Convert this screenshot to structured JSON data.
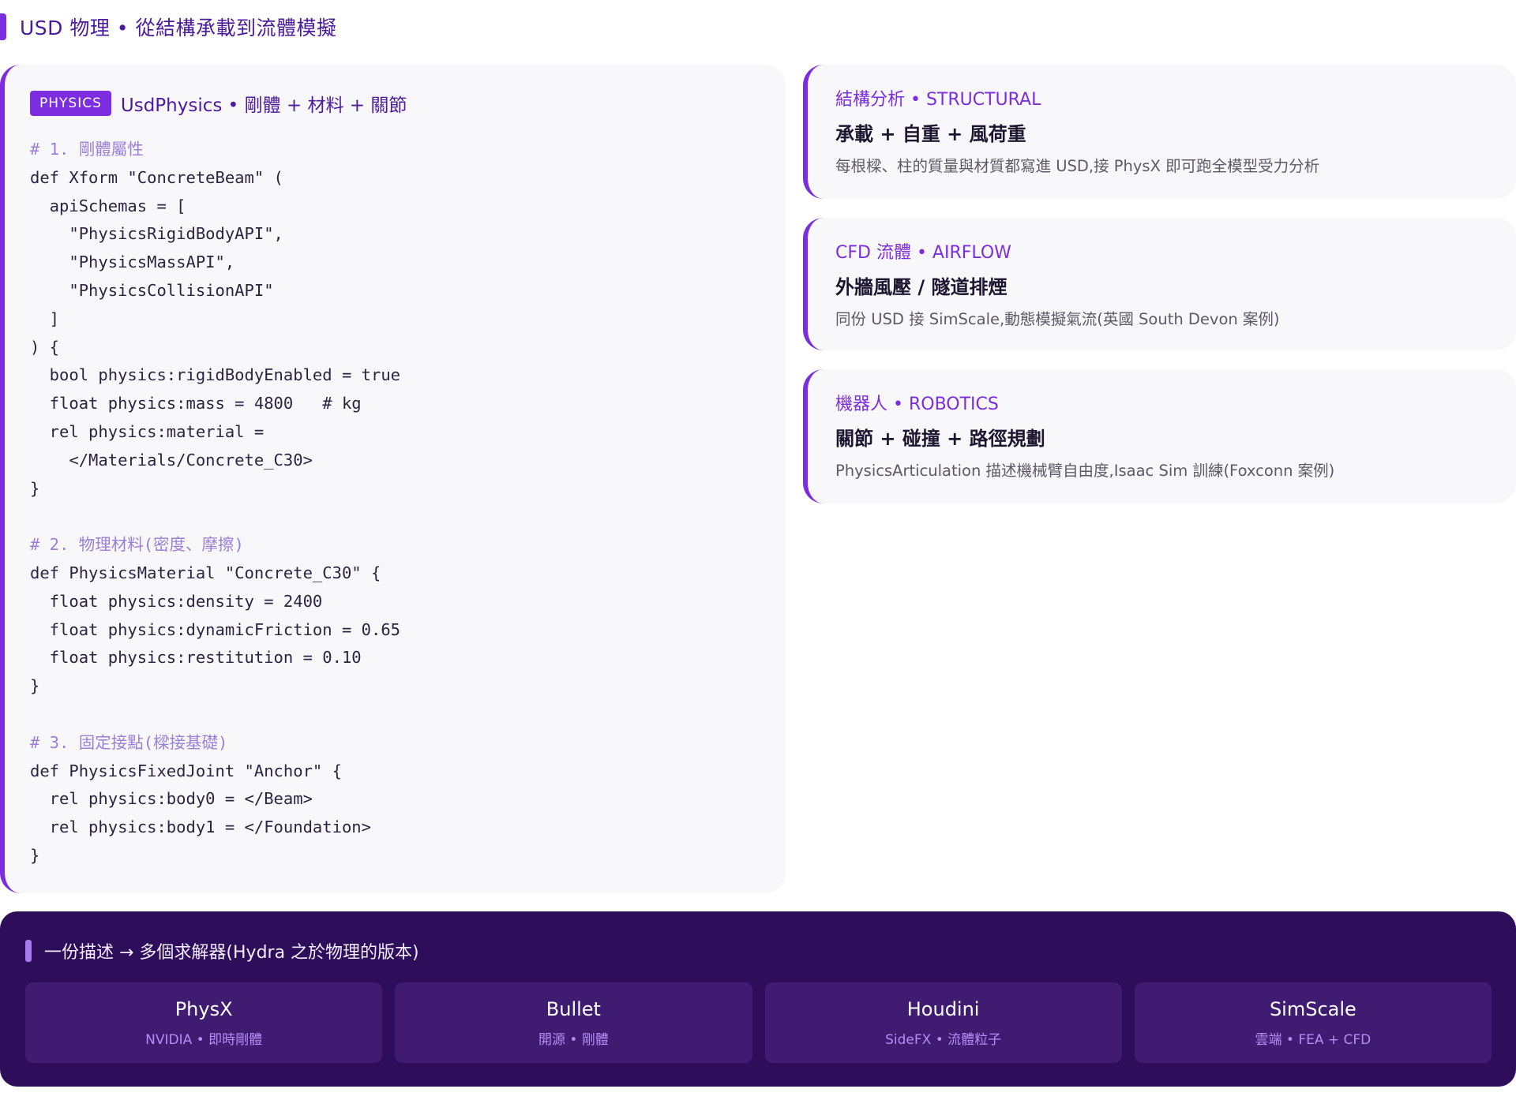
{
  "page": {
    "title": "USD 物理 • 從結構承載到流體模擬"
  },
  "code_panel": {
    "badge": "PHYSICS",
    "title": "UsdPhysics • 剛體 + 材料 + 關節",
    "lines": [
      {
        "text": "# 1. 剛體屬性",
        "kind": "comment"
      },
      {
        "text": "def Xform \"ConcreteBeam\" (",
        "kind": "code"
      },
      {
        "text": "  apiSchemas = [",
        "kind": "code"
      },
      {
        "text": "    \"PhysicsRigidBodyAPI\",",
        "kind": "code"
      },
      {
        "text": "    \"PhysicsMassAPI\",",
        "kind": "code"
      },
      {
        "text": "    \"PhysicsCollisionAPI\"",
        "kind": "code"
      },
      {
        "text": "  ]",
        "kind": "code"
      },
      {
        "text": ") {",
        "kind": "code"
      },
      {
        "text": "  bool physics:rigidBodyEnabled = true",
        "kind": "code"
      },
      {
        "text": "  float physics:mass = 4800   # kg",
        "kind": "code"
      },
      {
        "text": "  rel physics:material =",
        "kind": "code"
      },
      {
        "text": "    </Materials/Concrete_C30>",
        "kind": "code"
      },
      {
        "text": "}",
        "kind": "code"
      },
      {
        "text": "",
        "kind": "code"
      },
      {
        "text": "# 2. 物理材料(密度、摩擦)",
        "kind": "comment"
      },
      {
        "text": "def PhysicsMaterial \"Concrete_C30\" {",
        "kind": "code"
      },
      {
        "text": "  float physics:density = 2400",
        "kind": "code"
      },
      {
        "text": "  float physics:dynamicFriction = 0.65",
        "kind": "code"
      },
      {
        "text": "  float physics:restitution = 0.10",
        "kind": "code"
      },
      {
        "text": "}",
        "kind": "code"
      },
      {
        "text": "",
        "kind": "code"
      },
      {
        "text": "# 3. 固定接點(樑接基礎)",
        "kind": "comment"
      },
      {
        "text": "def PhysicsFixedJoint \"Anchor\" {",
        "kind": "code"
      },
      {
        "text": "  rel physics:body0 = </Beam>",
        "kind": "code"
      },
      {
        "text": "  rel physics:body1 = </Foundation>",
        "kind": "code"
      },
      {
        "text": "}",
        "kind": "code"
      }
    ]
  },
  "cards": [
    {
      "kicker": "結構分析 • STRUCTURAL",
      "title": "承載 + 自重 + 風荷重",
      "desc": "每根樑、柱的質量與材質都寫進 USD,接 PhysX 即可跑全模型受力分析"
    },
    {
      "kicker": "CFD 流體 • AIRFLOW",
      "title": "外牆風壓 / 隧道排煙",
      "desc": "同份 USD 接 SimScale,動態模擬氣流(英國 South Devon 案例)"
    },
    {
      "kicker": "機器人 • ROBOTICS",
      "title": "關節 + 碰撞 + 路徑規劃",
      "desc": "PhysicsArticulation 描述機械臂自由度,Isaac Sim 訓練(Foxconn 案例)"
    }
  ],
  "solvers": {
    "title": "一份描述 → 多個求解器(Hydra 之於物理的版本)",
    "items": [
      {
        "name": "PhysX",
        "sub": "NVIDIA • 即時剛體"
      },
      {
        "name": "Bullet",
        "sub": "開源 • 剛體"
      },
      {
        "name": "Houdini",
        "sub": "SideFX • 流體粒子"
      },
      {
        "name": "SimScale",
        "sub": "雲端 • FEA + CFD"
      }
    ]
  },
  "colors": {
    "accent": "#7c2de0",
    "title": "#4b1a9e",
    "band_bg": "#2e0e5a",
    "solver_card_bg": "#3f1c72",
    "solver_sub": "#b48cf5",
    "code_comment": "#9b7fd6"
  }
}
